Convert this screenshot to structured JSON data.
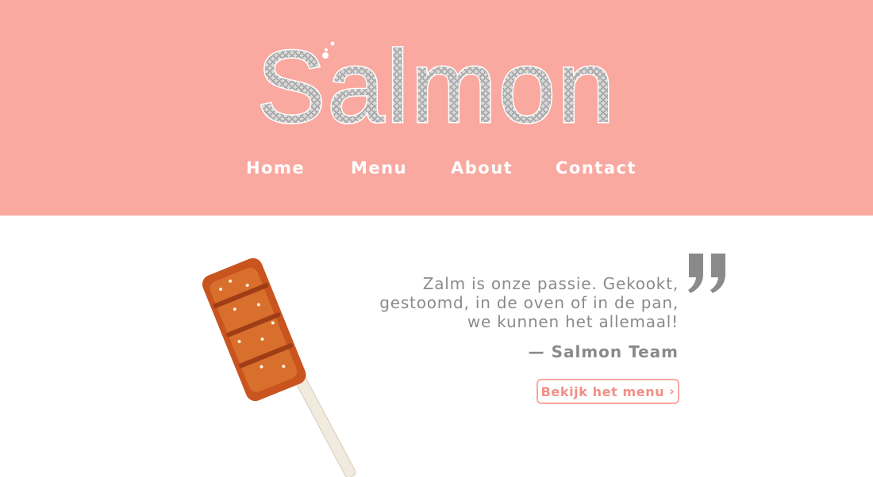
{
  "brand": {
    "logo_text": "Salmon"
  },
  "nav": {
    "items": [
      {
        "label": "Home"
      },
      {
        "label": "Menu"
      },
      {
        "label": "About"
      },
      {
        "label": "Contact"
      }
    ]
  },
  "hero": {
    "quote_lines": [
      "Zalm is onze passie. Gekookt,",
      "gestoomd, in de oven of in de pan,",
      "we kunnen het allemaal!"
    ],
    "author": "— Salmon Team",
    "cta_label": "Bekijk het menu",
    "cta_icon": "chevron-right-icon",
    "quote_icon": "closing-quote-icon"
  },
  "colors": {
    "header_bg": "#f9a9a0",
    "nav_text": "#ffffff",
    "body_text": "#8a8a8a",
    "accent": "#f28f86"
  }
}
